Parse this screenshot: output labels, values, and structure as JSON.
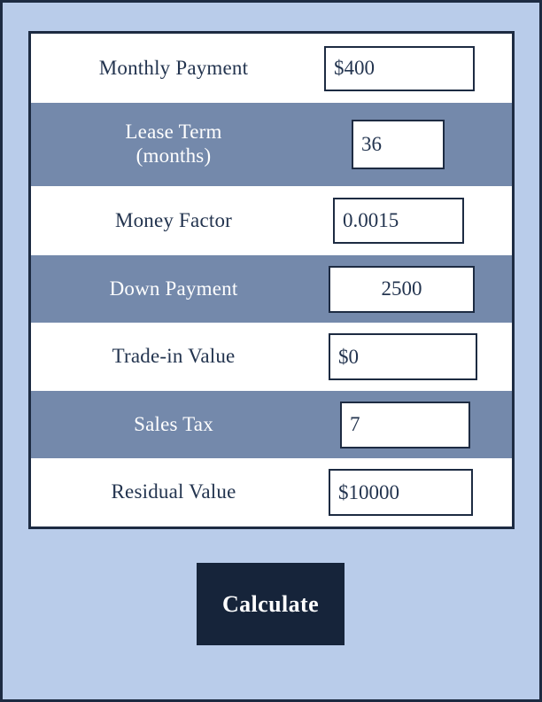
{
  "form": {
    "rows": [
      {
        "label": "Monthly Payment",
        "value": "$400",
        "align": "left"
      },
      {
        "label": "Lease Term\n(months)",
        "value": "36",
        "align": "left"
      },
      {
        "label": "Money Factor",
        "value": "0.0015",
        "align": "left"
      },
      {
        "label": "Down Payment",
        "value": "2500",
        "align": "center"
      },
      {
        "label": "Trade-in Value",
        "value": "$0",
        "align": "left"
      },
      {
        "label": "Sales Tax",
        "value": "7",
        "align": "left"
      },
      {
        "label": "Residual Value",
        "value": "$10000",
        "align": "left"
      }
    ]
  },
  "actions": {
    "calculate_label": "Calculate"
  },
  "colors": {
    "page_background": "#b9ccea",
    "page_border": "#1d2b42",
    "table_border": "#1d2b42",
    "row_odd_background": "#ffffff",
    "row_even_background": "#7489ab",
    "row_odd_text": "#23344f",
    "row_even_text": "#ffffff",
    "input_border": "#1d2b42",
    "input_background": "#ffffff",
    "input_text": "#23344f",
    "button_background": "#16243a",
    "button_text": "#ffffff"
  }
}
